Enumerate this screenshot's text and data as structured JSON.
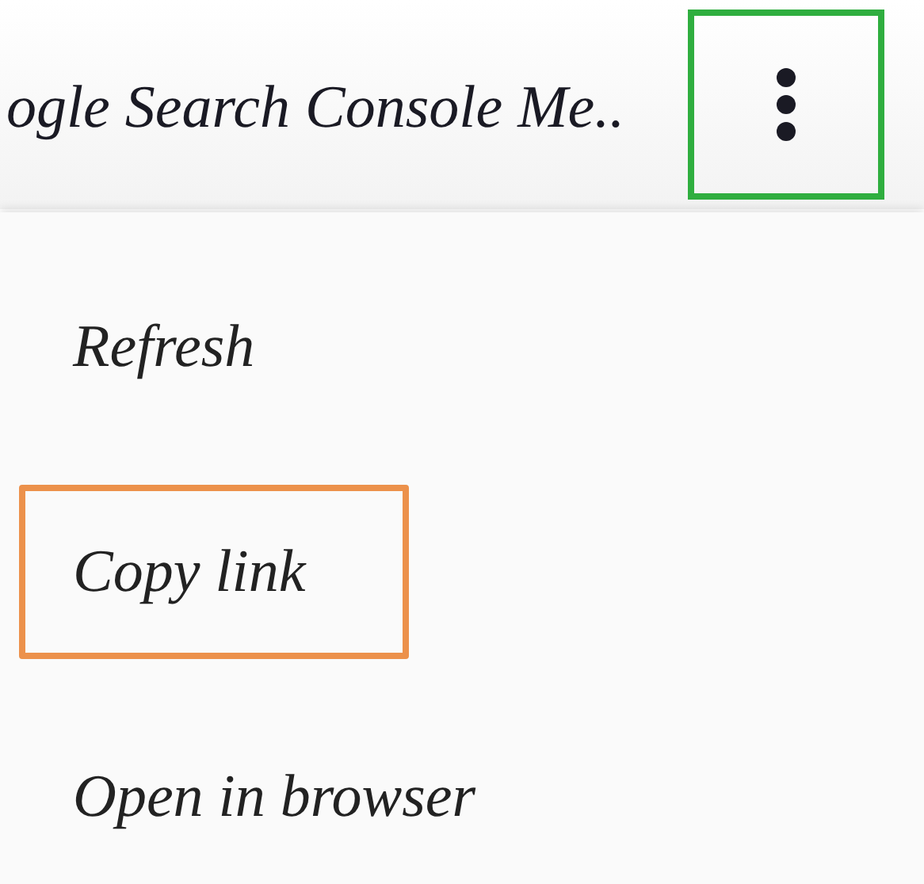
{
  "toolbar": {
    "title": "ogle Search Console Me..",
    "menu_button": {
      "highlighted": true
    }
  },
  "menu": {
    "items": [
      {
        "label": "Refresh",
        "highlighted": false
      },
      {
        "label": "Copy link",
        "highlighted": true
      },
      {
        "label": "Open in browser",
        "highlighted": false
      }
    ]
  }
}
